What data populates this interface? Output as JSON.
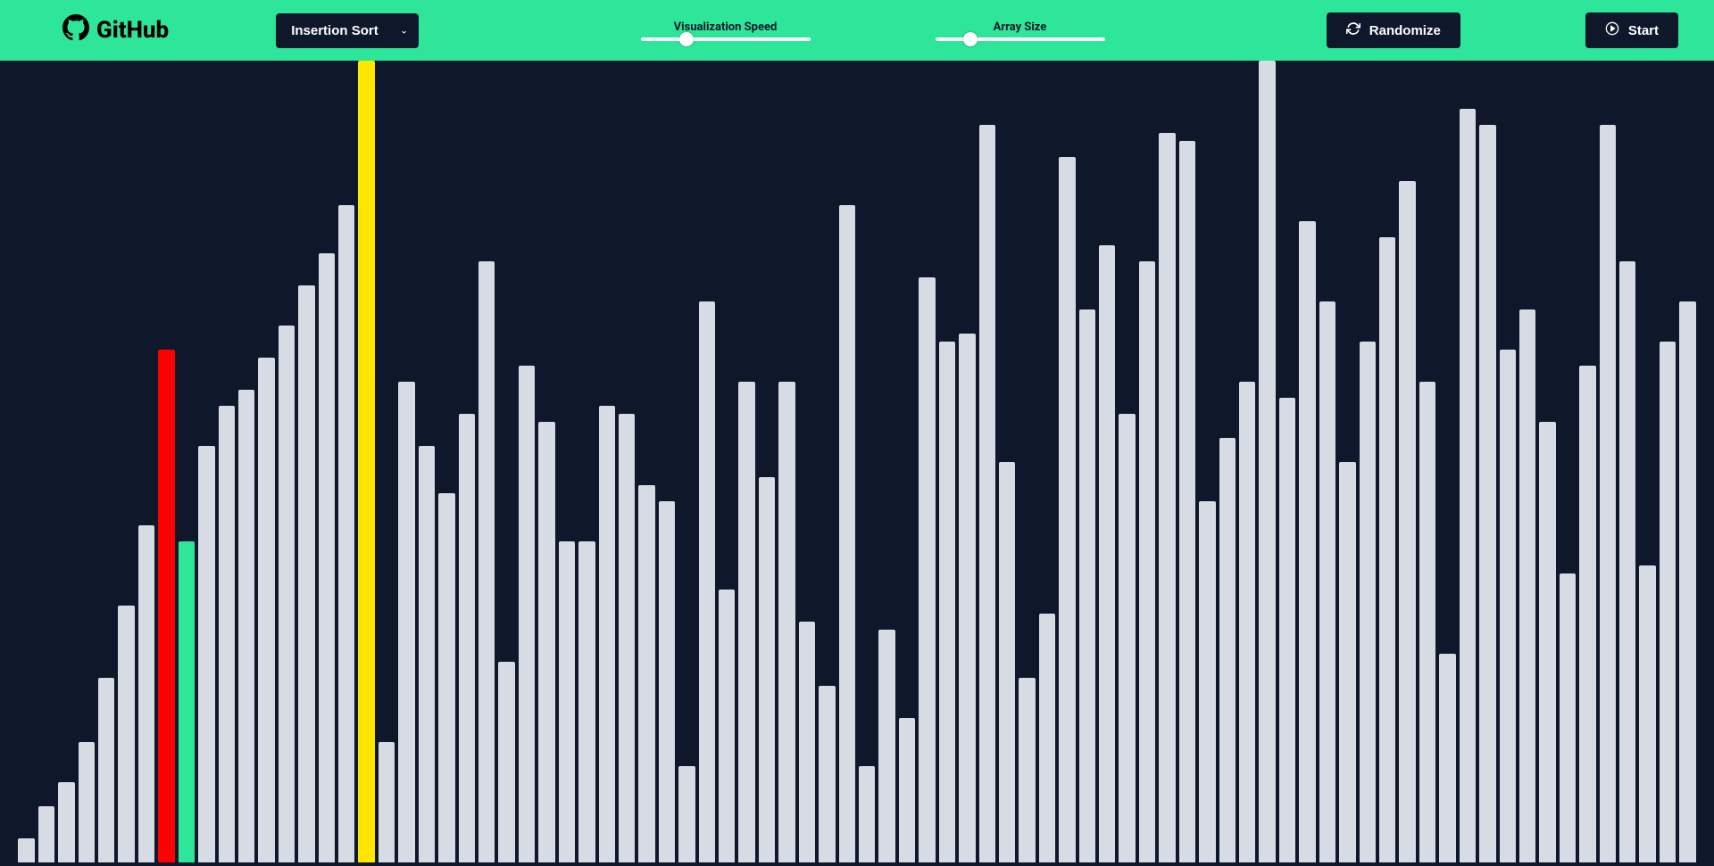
{
  "brand": {
    "label": "GitHub"
  },
  "toolbar": {
    "algorithm_selected": "Insertion Sort",
    "speed_label": "Visualization Speed",
    "size_label": "Array Size",
    "randomize_label": "Randomize",
    "start_label": "Start",
    "speed_value": 25,
    "size_value": 18
  },
  "colors": {
    "accent": "#2de69a",
    "bar_default": "#d7dbe3",
    "bar_current": "#ff0000",
    "bar_key": "#ffe600",
    "bar_aux": "#2de69a",
    "background": "#0f172a"
  },
  "chart_data": {
    "type": "bar",
    "title": "",
    "xlabel": "",
    "ylabel": "",
    "ylim": [
      0,
      100
    ],
    "colors_index": {
      "red": 7,
      "green": 8,
      "yellow": 17
    },
    "values": [
      3,
      7,
      10,
      15,
      23,
      32,
      42,
      64,
      40,
      52,
      57,
      59,
      63,
      67,
      72,
      76,
      82,
      100,
      15,
      60,
      52,
      46,
      56,
      75,
      25,
      62,
      55,
      40,
      40,
      57,
      56,
      47,
      45,
      12,
      70,
      34,
      60,
      48,
      60,
      30,
      22,
      82,
      12,
      29,
      18,
      73,
      65,
      66,
      92,
      50,
      23,
      31,
      88,
      69,
      77,
      56,
      75,
      91,
      90,
      45,
      53,
      60,
      100,
      58,
      80,
      70,
      50,
      65,
      78,
      85,
      60,
      26,
      94,
      92,
      64,
      69,
      55,
      36,
      62,
      92,
      75,
      37,
      65,
      70
    ]
  }
}
